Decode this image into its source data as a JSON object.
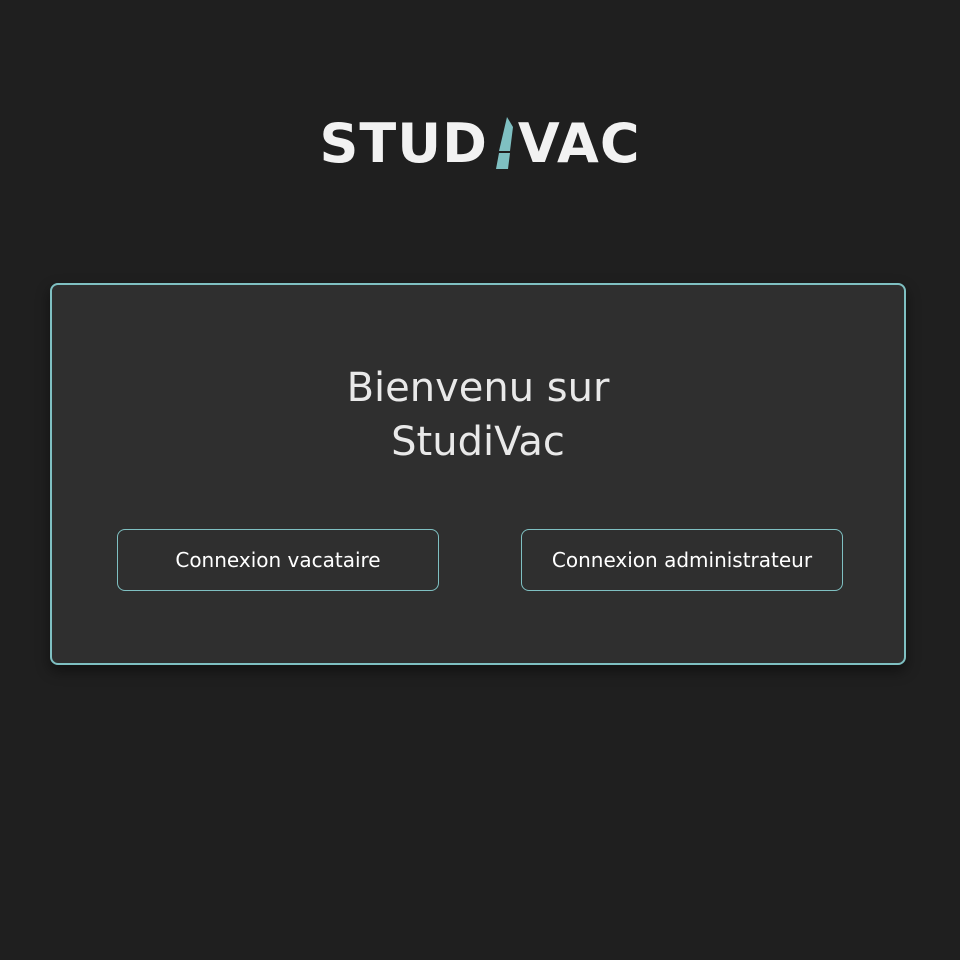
{
  "logo": {
    "text_before": "STUD",
    "text_after": "VAC",
    "pen_icon": "pen-icon",
    "accent_color": "#7fc0c2"
  },
  "card": {
    "title_line1": "Bienvenu sur",
    "title_line2": "StudiVac",
    "border_color": "#7fc0c2"
  },
  "buttons": {
    "vacataire_label": "Connexion vacataire",
    "admin_label": "Connexion administrateur"
  }
}
